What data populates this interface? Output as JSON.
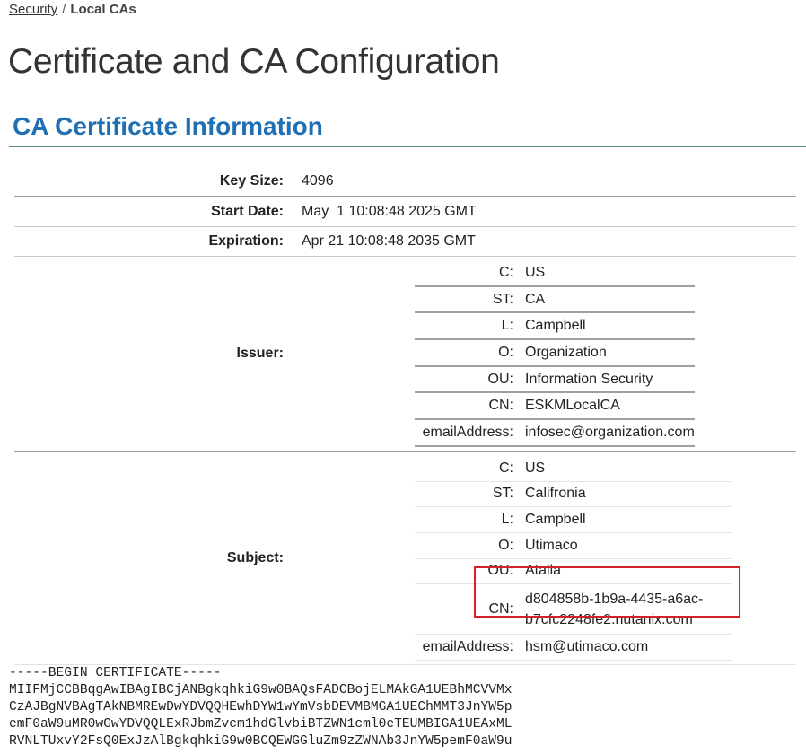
{
  "breadcrumb": {
    "parent": "Security",
    "separator": "/",
    "current": "Local CAs"
  },
  "page_title": "Certificate and CA Configuration",
  "section_title": "CA Certificate Information",
  "fields": {
    "key_size": {
      "label": "Key Size:",
      "value": "4096"
    },
    "start_date": {
      "label": "Start Date:",
      "value": "May  1 10:08:48 2025 GMT"
    },
    "expiration": {
      "label": "Expiration:",
      "value": "Apr 21 10:08:48 2035 GMT"
    }
  },
  "issuer": {
    "label": "Issuer:",
    "rows": [
      {
        "k": "C:",
        "v": "US"
      },
      {
        "k": "ST:",
        "v": "CA"
      },
      {
        "k": "L:",
        "v": "Campbell"
      },
      {
        "k": "O:",
        "v": "Organization"
      },
      {
        "k": "OU:",
        "v": "Information Security"
      },
      {
        "k": "CN:",
        "v": "ESKMLocalCA"
      },
      {
        "k": "emailAddress:",
        "v": "infosec@organization.com"
      }
    ]
  },
  "subject": {
    "label": "Subject:",
    "rows": [
      {
        "k": "C:",
        "v": "US"
      },
      {
        "k": "ST:",
        "v": "Califronia"
      },
      {
        "k": "L:",
        "v": "Campbell"
      },
      {
        "k": "O:",
        "v": "Utimaco"
      },
      {
        "k": "OU:",
        "v": "Atalla"
      },
      {
        "k": "CN:",
        "v": "d804858b-1b9a-4435-a6ac-b7cfc2248fe2.nutanix.com"
      },
      {
        "k": "emailAddress:",
        "v": "hsm@utimaco.com"
      }
    ]
  },
  "highlight_color": "#d3202a",
  "certificate_pem": [
    "-----BEGIN CERTIFICATE-----",
    "MIIFMjCCBBqgAwIBAgIBCjANBgkqhkiG9w0BAQsFADCBojELMAkGA1UEBhMCVVMx",
    "CzAJBgNVBAgTAkNBMREwDwYDVQQHEwhDYW1wYmVsbDEVMBMGA1UEChMMT3JnYW5p",
    "emF0aW9uMR0wGwYDVQQLExRJbmZvcm1hdGlvbiBTZWN1cml0eTEUMBIGA1UEAxML",
    "RVNLTUxvY2FsQ0ExJzAlBgkqhkiG9w0BCQEWGGluZm9zZWNAb3JnYW5pemF0aW9u"
  ]
}
